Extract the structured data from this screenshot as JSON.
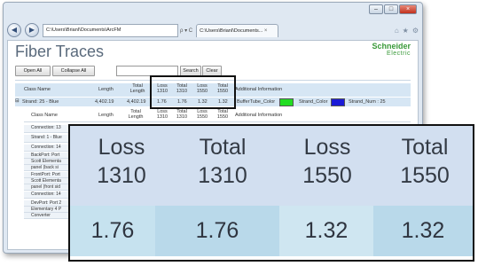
{
  "browser": {
    "address_text": "C:\\Users\\BrianI\\Documents\\ArcFM",
    "address_tools": "ρ ▾ C",
    "tab_label": "C:\\Users\\BrianI\\Documents...",
    "tab_close": "×",
    "right_icons": [
      "⌂",
      "★",
      "⚙"
    ],
    "window_buttons": [
      "–",
      "□",
      "×"
    ]
  },
  "page": {
    "title": "Fiber Traces",
    "logo_main": "Schneider",
    "logo_sub": "Electric",
    "toolbar": {
      "open_all": "Open All",
      "collapse_all": "Collapse All",
      "search": "Search",
      "clear": "Clear",
      "search_value": ""
    },
    "header": {
      "class_name": "Class Name",
      "length": "Length",
      "total_length": "Total Length",
      "loss_1310": "Loss 1310",
      "total_1310": "Total 1310",
      "loss_1550": "Loss 1550",
      "total_1550": "Total 1550",
      "additional": "Additional Information"
    },
    "strand_row": {
      "expander": "⊟",
      "name": "Strand: 25 - Blue",
      "length": "4,402.19",
      "total_length": "4,402.19",
      "loss_1310": "1.76",
      "total_1310": "1.76",
      "loss_1550": "1.32",
      "total_1550": "1.32",
      "buffer_label": "BufferTube_Color",
      "buffer_color": "#22dd22",
      "strand_color_label": "Strand_Color",
      "strand_color": "#1a1ad6",
      "strand_num": "Strand_Num : 25"
    },
    "sub_header": {
      "class_name": "Class Name",
      "length": "Length",
      "total_length": "Total Length",
      "loss_1310": "Loss 1310",
      "total_1310": "Total 1310",
      "loss_1550": "Loss 1550",
      "total_1550": "Total 1550",
      "additional": "Additional Information"
    },
    "list_rows": [
      "Connection: 13",
      "Strand: 1 - Blue",
      "Connection: 14",
      "BackPort: Port",
      "Scott Elementa",
      "panel (back si",
      "FrontPort: Port",
      "Scott Elementa",
      "panel (front sid",
      "Connection: 14",
      "DevPort: Port 2",
      "Elementary 4 P",
      "Converter"
    ]
  },
  "zoom": {
    "headers": [
      {
        "line1": "Loss",
        "line2": "1310"
      },
      {
        "line1": "Total",
        "line2": "1310"
      },
      {
        "line1": "Loss",
        "line2": "1550"
      },
      {
        "line1": "Total",
        "line2": "1550"
      }
    ],
    "values": [
      "1.76",
      "1.76",
      "1.32",
      "1.32"
    ]
  }
}
